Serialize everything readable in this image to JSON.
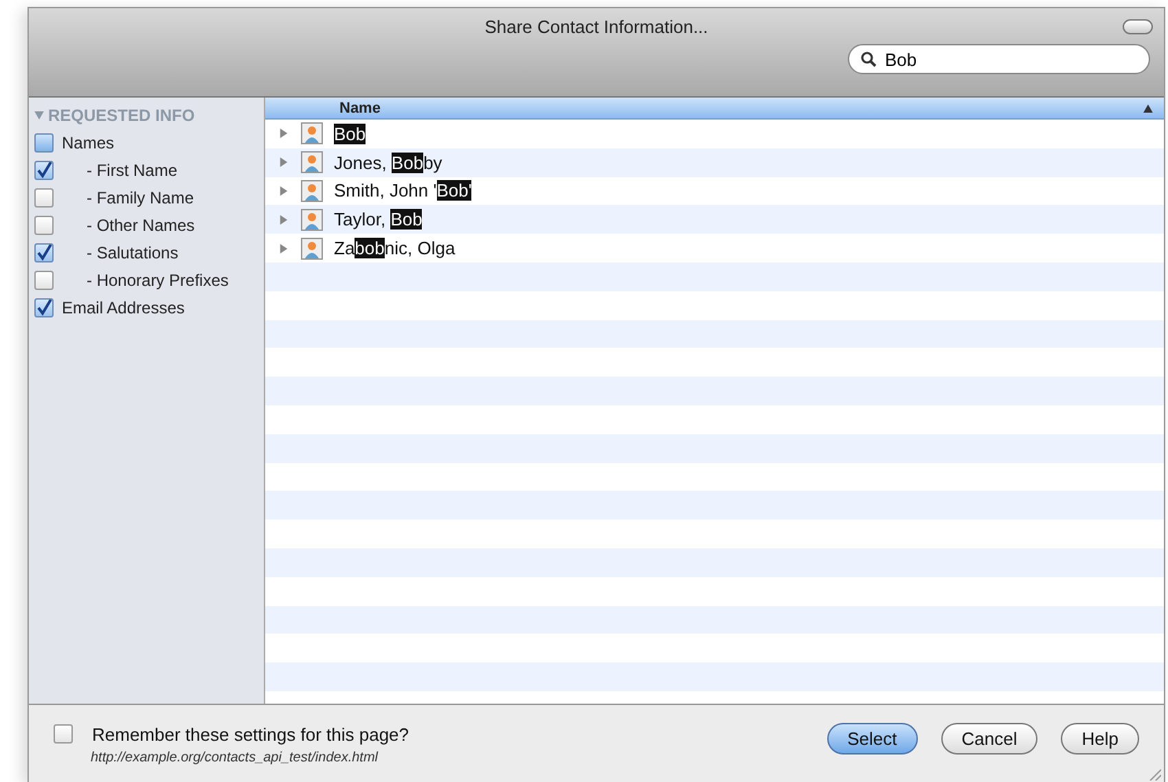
{
  "window": {
    "title": "Share Contact Information..."
  },
  "search": {
    "value": "Bob"
  },
  "sidebar": {
    "heading": "REQUESTED INFO",
    "items": [
      {
        "label": "Names",
        "checked": false,
        "mixed": true,
        "kind": "group"
      },
      {
        "label": "- First Name",
        "checked": true,
        "mixed": false,
        "kind": "sub"
      },
      {
        "label": "- Family Name",
        "checked": false,
        "mixed": false,
        "kind": "sub"
      },
      {
        "label": "- Other Names",
        "checked": false,
        "mixed": false,
        "kind": "sub"
      },
      {
        "label": "- Salutations",
        "checked": true,
        "mixed": false,
        "kind": "sub"
      },
      {
        "label": "- Honorary Prefixes",
        "checked": false,
        "mixed": false,
        "kind": "sub"
      },
      {
        "label": "Email Addresses",
        "checked": true,
        "mixed": false,
        "kind": "group"
      }
    ]
  },
  "table": {
    "columns": [
      {
        "label": "Name"
      }
    ],
    "rows": [
      {
        "name": "**Bob**"
      },
      {
        "name": "Jones, **Bob**by"
      },
      {
        "name": "Smith, John '**Bob'**"
      },
      {
        "name": "Taylor, **Bob**"
      },
      {
        "name": "Za**bob**nic, Olga"
      }
    ]
  },
  "footer": {
    "remember": {
      "label": "Remember these settings for this page?",
      "checked": false
    },
    "url": "http://example.org/contacts_api_test/index.html",
    "buttons": [
      {
        "label": "Select",
        "default": true
      },
      {
        "label": "Cancel",
        "default": false
      },
      {
        "label": "Help",
        "default": false
      }
    ]
  }
}
